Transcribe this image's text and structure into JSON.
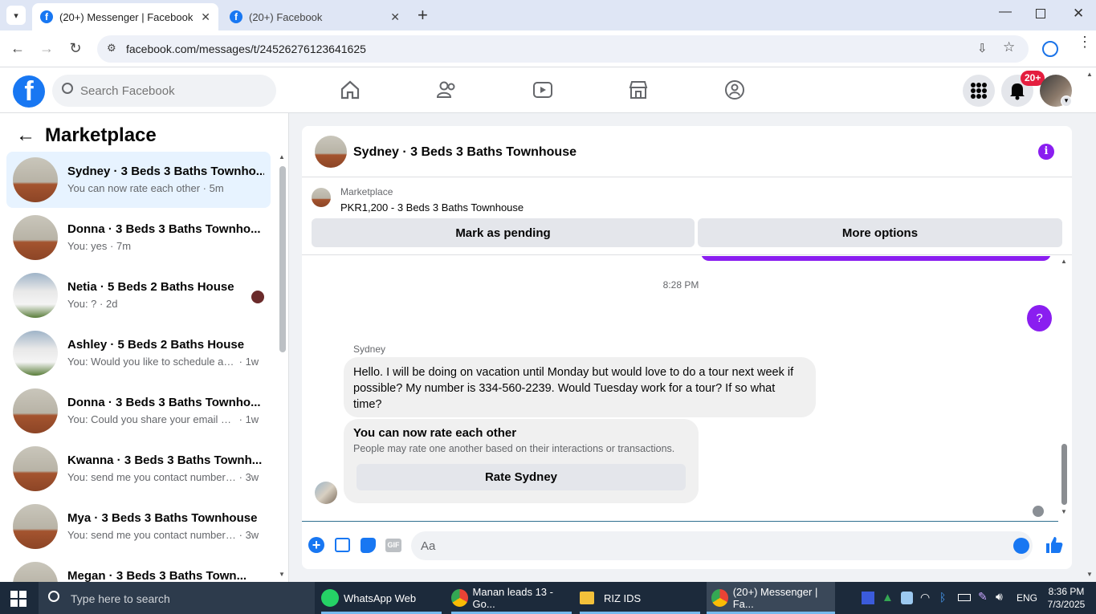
{
  "browser": {
    "tabs": [
      {
        "label": "(20+) Messenger | Facebook"
      },
      {
        "label": "(20+) Facebook"
      }
    ],
    "url": "facebook.com/messages/t/24526276123641625"
  },
  "fb_header": {
    "search_placeholder": "Search Facebook",
    "notif_badge": "20+"
  },
  "sidebar": {
    "title": "Marketplace",
    "conversations": [
      {
        "name": "Sydney · 3 Beds 3 Baths Townho...",
        "preview": "You can now rate each other",
        "time": "5m"
      },
      {
        "name": "Donna · 3 Beds 3 Baths Townho...",
        "preview": "You: yes",
        "time": "7m"
      },
      {
        "name": "Netia · 5 Beds 2 Baths House",
        "preview": "You: ?",
        "time": "2d"
      },
      {
        "name": "Ashley · 5 Beds 2 Baths House",
        "preview": "You: Would you like to schedule a t...",
        "time": "1w"
      },
      {
        "name": "Donna · 3 Beds 3 Baths Townho...",
        "preview": "You: Could you share your email ad...",
        "time": "1w"
      },
      {
        "name": "Kwanna · 3 Beds 3 Baths Townh...",
        "preview": "You: send me you contact number ...",
        "time": "3w"
      },
      {
        "name": "Mya · 3 Beds 3 Baths Townhouse",
        "preview": "You: send me you contact number ...",
        "time": "3w"
      },
      {
        "name": "Megan · 3 Beds 3 Baths Town...",
        "preview": "",
        "time": ""
      }
    ]
  },
  "chat": {
    "title": "Sydney · 3 Beds 3 Baths Townhouse",
    "listing_label": "Marketplace",
    "listing_price_title": "PKR1,200 - 3 Beds 3 Baths Townhouse",
    "mark_pending_label": "Mark as pending",
    "more_options_label": "More options",
    "timestamp": "8:28 PM",
    "outgoing_message": "?",
    "sender_name": "Sydney",
    "incoming_message": "Hello. I will be doing on vacation until Monday but would love to do a tour next week if possible? My number is 334-560-2239. Would Tuesday work for a tour? If so what time?",
    "rate_title": "You can now rate each other",
    "rate_subtitle": "People may rate one another based on their interactions or transactions.",
    "rate_button": "Rate Sydney",
    "composer_placeholder": "Aa"
  },
  "taskbar": {
    "search_placeholder": "Type here to search",
    "apps": [
      {
        "label": "WhatsApp Web"
      },
      {
        "label": "Manan leads 13 - Go..."
      },
      {
        "label": "RIZ IDS"
      },
      {
        "label": "(20+) Messenger | Fa..."
      }
    ],
    "language": "ENG",
    "time": "8:36 PM",
    "date": "7/3/2025"
  },
  "colors": {
    "fb_blue": "#1877f2",
    "messenger_purple": "#8a1ef0",
    "badge_red": "#e41e3f"
  }
}
